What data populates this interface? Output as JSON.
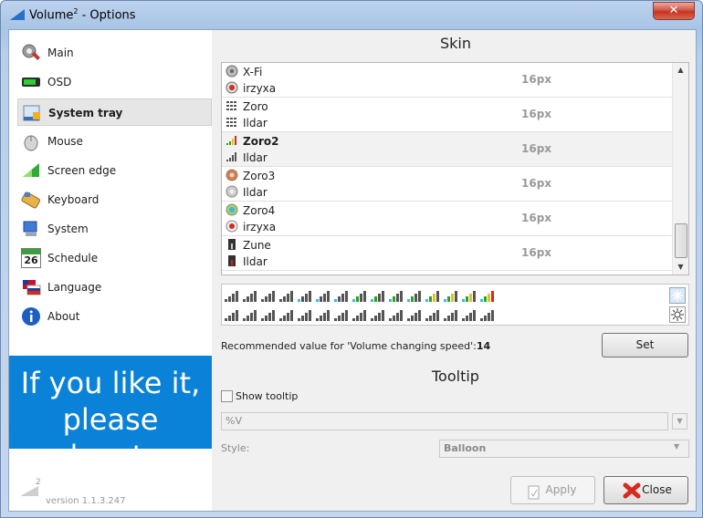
{
  "window": {
    "title": "Volume",
    "title_sup": "2",
    "title_rest": " - Options",
    "close_symbol": "✕"
  },
  "sidebar": {
    "items": [
      {
        "label": "Main",
        "icon": "settings-gear-icon"
      },
      {
        "label": "OSD",
        "icon": "osd-bar-icon"
      },
      {
        "label": "System tray",
        "icon": "system-tray-icon"
      },
      {
        "label": "Mouse",
        "icon": "mouse-icon"
      },
      {
        "label": "Screen edge",
        "icon": "screen-edge-icon"
      },
      {
        "label": "Keyboard",
        "icon": "keyboard-icon"
      },
      {
        "label": "System",
        "icon": "computer-icon"
      },
      {
        "label": "Schedule",
        "icon": "calendar-icon"
      },
      {
        "label": "Language",
        "icon": "flags-icon"
      },
      {
        "label": "About",
        "icon": "info-icon"
      }
    ],
    "selected": "System tray",
    "schedule_day": "26",
    "donate_line1": "If you like it,",
    "donate_line2": "please donate",
    "logo_sup": "2",
    "version": "version 1.1.3.247"
  },
  "skin": {
    "title": "Skin",
    "rows": [
      {
        "name": "X-Fi",
        "author": "irzyxa",
        "size": "16px",
        "icon": "xfi-icon",
        "selected": false
      },
      {
        "name": "Zoro",
        "author": "Ildar",
        "size": "16px",
        "icon": "zoro-bars-icon",
        "selected": false
      },
      {
        "name": "Zoro2",
        "author": "Ildar",
        "size": "16px",
        "icon": "zoro2-bars-icon",
        "selected": true
      },
      {
        "name": "Zoro3",
        "author": "Ildar",
        "size": "16px",
        "icon": "zoro3-knob-icon",
        "selected": false
      },
      {
        "name": "Zoro4",
        "author": "irzyxa",
        "size": "16px",
        "icon": "zoro4-knob-icon",
        "selected": false
      },
      {
        "name": "Zune",
        "author": "Ildar",
        "size": "16px",
        "icon": "zune-icon",
        "selected": false
      }
    ],
    "recommended_prefix": "Recommended value for 'Volume changing speed':",
    "recommended_value": "14",
    "set_label": "Set",
    "colors": {
      "green": "#27a51e",
      "yellow": "#e8c21a",
      "red": "#d9281e",
      "gray": "#555555",
      "cyan": "#3fb6d9"
    }
  },
  "tooltip": {
    "title": "Tooltip",
    "show_label": "Show tooltip",
    "show_checked": false,
    "format_value": "%V",
    "style_label": "Style:",
    "style_value": "Balloon"
  },
  "footer": {
    "apply_label": "Apply",
    "close_label": "Close"
  }
}
